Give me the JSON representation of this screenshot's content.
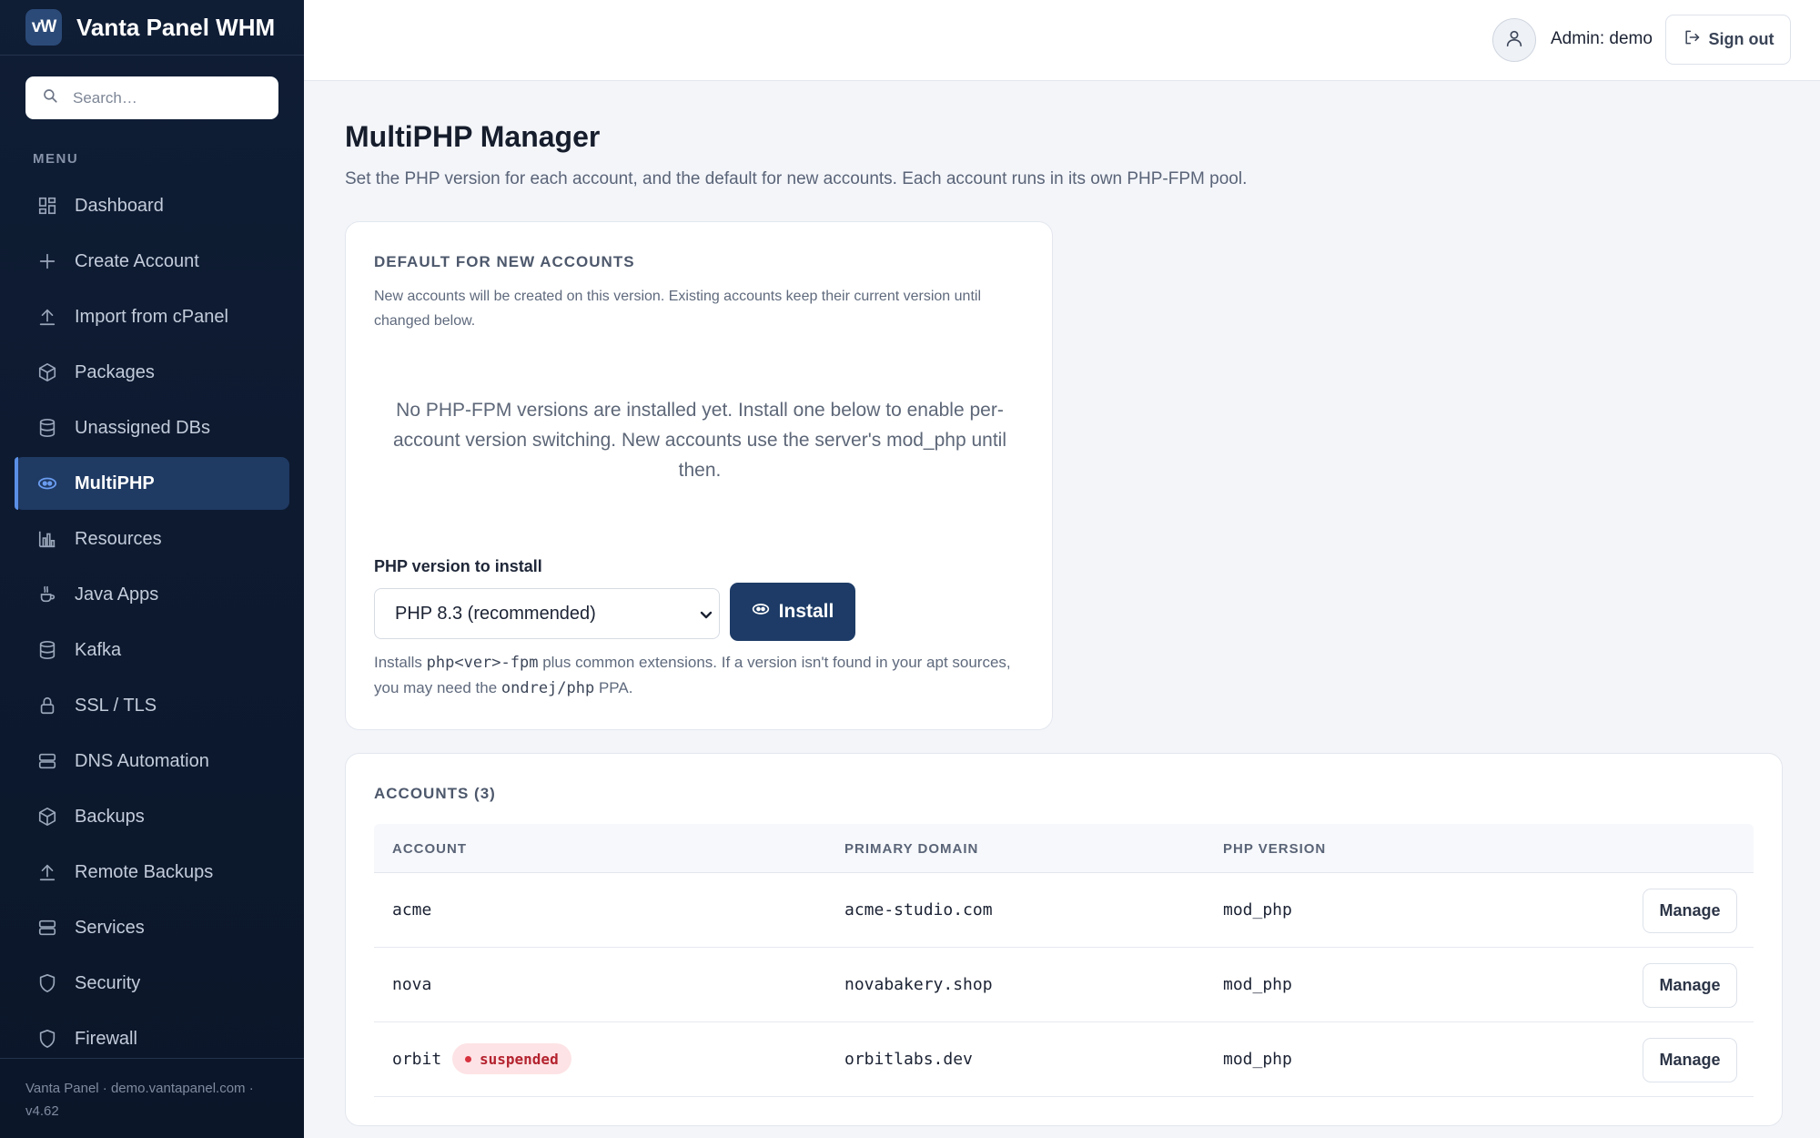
{
  "brand": {
    "logo_text": "vW",
    "name": "Vanta Panel WHM"
  },
  "search": {
    "placeholder": "Search…"
  },
  "menu": {
    "label": "MENU",
    "items": [
      {
        "label": "Dashboard",
        "icon": "dashboard-icon"
      },
      {
        "label": "Create Account",
        "icon": "plus-icon"
      },
      {
        "label": "Import from cPanel",
        "icon": "upload-icon"
      },
      {
        "label": "Packages",
        "icon": "package-icon"
      },
      {
        "label": "Unassigned DBs",
        "icon": "database-icon"
      },
      {
        "label": "MultiPHP",
        "icon": "php-icon",
        "active": true
      },
      {
        "label": "Resources",
        "icon": "bar-chart-icon"
      },
      {
        "label": "Java Apps",
        "icon": "coffee-icon"
      },
      {
        "label": "Kafka",
        "icon": "database-icon"
      },
      {
        "label": "SSL / TLS",
        "icon": "lock-icon"
      },
      {
        "label": "DNS Automation",
        "icon": "server-icon"
      },
      {
        "label": "Backups",
        "icon": "package-icon"
      },
      {
        "label": "Remote Backups",
        "icon": "upload-icon"
      },
      {
        "label": "Services",
        "icon": "server-icon"
      },
      {
        "label": "Security",
        "icon": "shield-icon"
      },
      {
        "label": "Firewall",
        "icon": "shield-icon"
      }
    ]
  },
  "footer": {
    "text": "Vanta Panel · demo.vantapanel.com · v4.62"
  },
  "topbar": {
    "admin_label": "Admin: demo",
    "signout_label": "Sign out"
  },
  "page": {
    "title": "MultiPHP Manager",
    "subtitle": "Set the PHP version for each account, and the default for new accounts. Each account runs in its own PHP-FPM pool."
  },
  "default_card": {
    "heading": "DEFAULT FOR NEW ACCOUNTS",
    "description": "New accounts will be created on this version. Existing accounts keep their current version until changed below.",
    "empty_message": "No PHP-FPM versions are installed yet. Install one below to enable per-account version switching. New accounts use the server's mod_php until then.",
    "field_label": "PHP version to install",
    "selected_version": "PHP 8.3 (recommended)",
    "install_label": "Install",
    "note_prefix": "Installs ",
    "note_code1": "php<ver>-fpm",
    "note_middle": " plus common extensions. If a version isn't found in your apt sources, you may need the ",
    "note_code2": "ondrej/php",
    "note_suffix": " PPA."
  },
  "accounts": {
    "heading": "ACCOUNTS (3)",
    "columns": [
      "ACCOUNT",
      "PRIMARY DOMAIN",
      "PHP VERSION"
    ],
    "rows": [
      {
        "account": "acme",
        "domain": "acme-studio.com",
        "php": "mod_php",
        "status": "",
        "action": "Manage"
      },
      {
        "account": "nova",
        "domain": "novabakery.shop",
        "php": "mod_php",
        "status": "",
        "action": "Manage"
      },
      {
        "account": "orbit",
        "domain": "orbitlabs.dev",
        "php": "mod_php",
        "status": "suspended",
        "action": "Manage"
      }
    ]
  },
  "colors": {
    "sidebar_bg": "#0f1d35",
    "active_item_bg": "#1f3a63",
    "active_accent": "#5a8fe6",
    "primary_button": "#1d3b66",
    "suspended_badge_bg": "#fde3e5",
    "suspended_text": "#b4232f"
  }
}
